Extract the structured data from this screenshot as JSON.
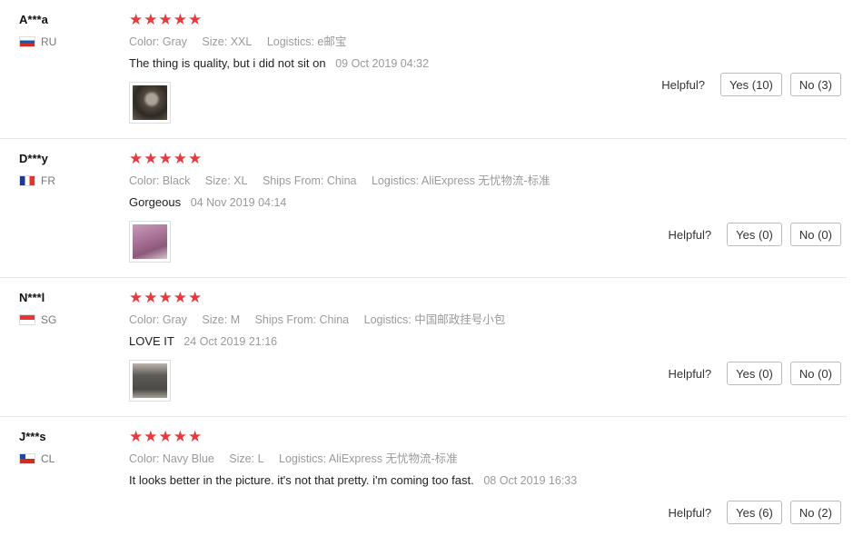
{
  "reviews": [
    {
      "user": "A***a",
      "country": "RU",
      "stars": "★★★★★",
      "attributes": [
        {
          "key": "Color:",
          "value": "Gray"
        },
        {
          "key": "Size:",
          "value": "XXL"
        },
        {
          "key": "Logistics:",
          "value": "e邮宝"
        }
      ],
      "text": "The thing is quality, but i did not sit on",
      "date": "09 Oct 2019 04:32",
      "helpful_label": "Helpful?",
      "yes_label": "Yes (10)",
      "no_label": "No (3)"
    },
    {
      "user": "D***y",
      "country": "FR",
      "stars": "★★★★★",
      "attributes": [
        {
          "key": "Color:",
          "value": "Black"
        },
        {
          "key": "Size:",
          "value": "XL"
        },
        {
          "key": "Ships From:",
          "value": "China"
        },
        {
          "key": "Logistics:",
          "value": "AliExpress 无忧物流-标准"
        }
      ],
      "text": "Gorgeous",
      "date": "04 Nov 2019 04:14",
      "helpful_label": "Helpful?",
      "yes_label": "Yes (0)",
      "no_label": "No (0)"
    },
    {
      "user": "N***l",
      "country": "SG",
      "stars": "★★★★★",
      "attributes": [
        {
          "key": "Color:",
          "value": "Gray"
        },
        {
          "key": "Size:",
          "value": "M"
        },
        {
          "key": "Ships From:",
          "value": "China"
        },
        {
          "key": "Logistics:",
          "value": "中国邮政挂号小包"
        }
      ],
      "text": "LOVE IT",
      "date": "24 Oct 2019 21:16",
      "helpful_label": "Helpful?",
      "yes_label": "Yes (0)",
      "no_label": "No (0)"
    },
    {
      "user": "J***s",
      "country": "CL",
      "stars": "★★★★★",
      "attributes": [
        {
          "key": "Color:",
          "value": "Navy Blue"
        },
        {
          "key": "Size:",
          "value": "L"
        },
        {
          "key": "Logistics:",
          "value": "AliExpress 无忧物流-标准"
        }
      ],
      "text": "It looks better in the picture. it's not that pretty. i'm coming too fast.",
      "date": "08 Oct 2019 16:33",
      "helpful_label": "Helpful?",
      "yes_label": "Yes (6)",
      "no_label": "No (2)"
    }
  ],
  "colors": {
    "star": "#e8393f",
    "muted_text": "#9a9a9a",
    "divider": "#e6e6e6"
  }
}
